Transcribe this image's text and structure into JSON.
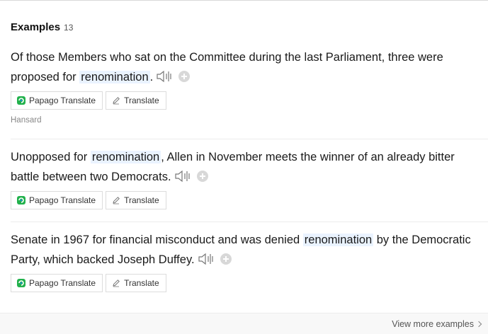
{
  "header": {
    "title": "Examples",
    "count": "13"
  },
  "examples": [
    {
      "before": "Of those Members who sat on the Committee during the last Parliament, three were proposed for ",
      "keyword": "renomination",
      "after": ".",
      "source": "Hansard"
    },
    {
      "before": "Unopposed for ",
      "keyword": "renomination",
      "after": ", Allen in November meets the winner of an already bitter battle between two Democrats.",
      "source": ""
    },
    {
      "before": "Senate in 1967 for financial misconduct and was denied ",
      "keyword": "renomination",
      "after": " by the Democratic Party, which backed Joseph Duffey.",
      "source": ""
    }
  ],
  "buttons": {
    "papago": "Papago Translate",
    "translate": "Translate"
  },
  "footer": {
    "more": "View more examples"
  },
  "colors": {
    "highlight": "#eaf3ff",
    "papago_green": "#22b14c",
    "papago_blue": "#1e88e5"
  }
}
